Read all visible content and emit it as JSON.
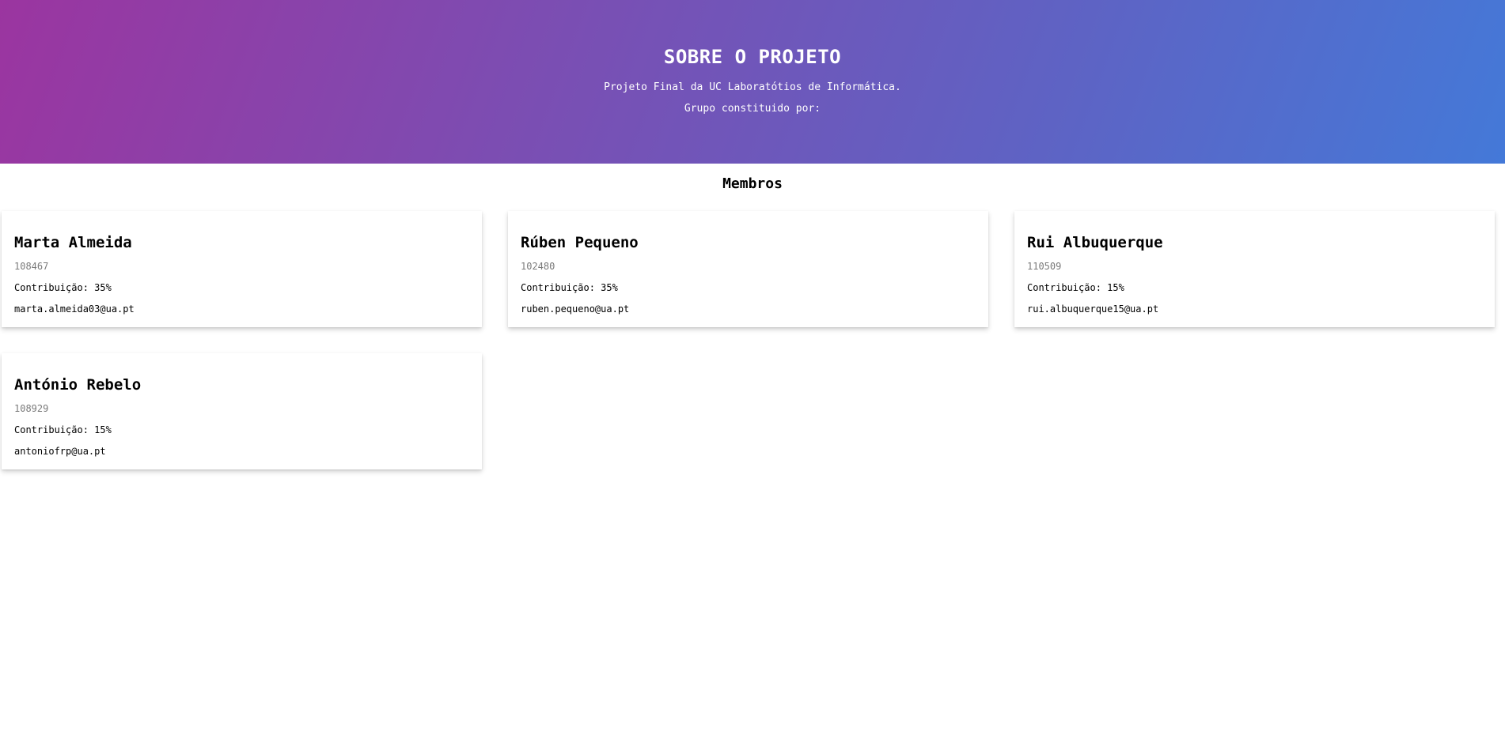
{
  "hero": {
    "title": "SOBRE O PROJETO",
    "line1": "Projeto Final da UC Laboratótios de Informática.",
    "line2": "Grupo constituido por:"
  },
  "members_heading": "Membros",
  "members": [
    {
      "name": "Marta Almeida",
      "id": "108467",
      "contribution": "Contribuição: 35%",
      "email": "marta.almeida03@ua.pt"
    },
    {
      "name": "Rúben Pequeno",
      "id": "102480",
      "contribution": "Contribuição: 35%",
      "email": "ruben.pequeno@ua.pt"
    },
    {
      "name": "Rui Albuquerque",
      "id": "110509",
      "contribution": "Contribuição: 15%",
      "email": "rui.albuquerque15@ua.pt"
    },
    {
      "name": "António Rebelo",
      "id": "108929",
      "contribution": "Contribuição: 15%",
      "email": "antoniofrp@ua.pt"
    }
  ],
  "colors": {
    "hero_gradient_start": "#9b35a0",
    "hero_gradient_end": "#4479d8",
    "id_text": "#7a7a7a"
  }
}
